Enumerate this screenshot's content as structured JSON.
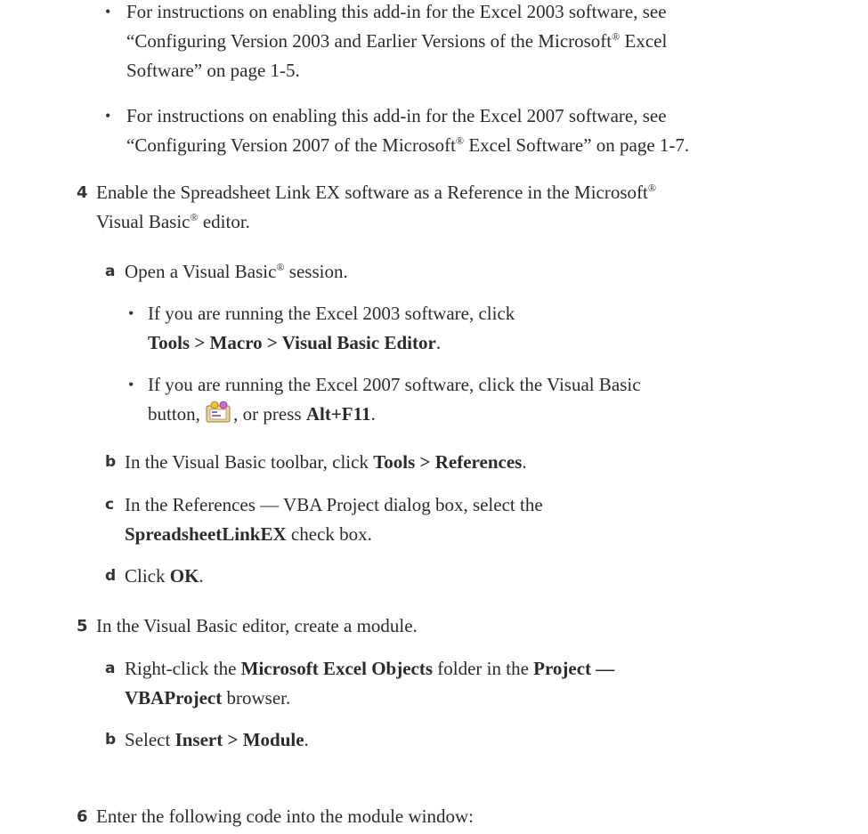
{
  "bullets_top": [
    {
      "line1": "For instructions on enabling this add-in for the Excel 2003 software, see",
      "line2_a": "“Configuring Version 2003 and Earlier Versions of the Microsoft",
      "line2_reg": "®",
      "line2_b": " Excel",
      "line3": "Software” on page 1-5."
    },
    {
      "line1": "For instructions on enabling this add-in for the Excel 2007 software, see",
      "line2_a": "“Configuring Version 2007 of the Microsoft",
      "line2_reg": "®",
      "line2_b": " Excel Software” on page 1-7."
    }
  ],
  "bullet_char": "•",
  "step4": {
    "num": "4",
    "line1_a": "Enable the Spreadsheet Link EX software as a Reference in the Microsoft",
    "reg": "®",
    "line2_a": "Visual Basic",
    "line2_b": " editor.",
    "a": {
      "letter": "a",
      "text_a": "Open a Visual Basic",
      "text_b": " session.",
      "bullet1": {
        "line1": "If you are running the Excel 2003 software, click",
        "line2_bold": "Tools > Macro > Visual Basic Editor",
        "line2_end": "."
      },
      "bullet2": {
        "line1": "If you are running the Excel 2007 software, click the Visual Basic",
        "line2_a": "button, ",
        "line2_b": ", or press ",
        "line2_bold": "Alt+F11",
        "line2_end": "."
      }
    },
    "b": {
      "letter": "b",
      "text": "In the Visual Basic toolbar, click ",
      "bold": "Tools > References",
      "end": "."
    },
    "c": {
      "letter": "c",
      "line1": "In the References — VBA Project dialog box, select the",
      "line2_bold": "SpreadsheetLinkEX",
      "line2_end": " check box."
    },
    "d": {
      "letter": "d",
      "text": "Click ",
      "bold": "OK",
      "end": "."
    }
  },
  "step5": {
    "num": "5",
    "text": "In the Visual Basic editor, create a module.",
    "a": {
      "letter": "a",
      "text": "Right-click the ",
      "bold1": "Microsoft Excel Objects",
      "mid": " folder in the ",
      "bold2": "Project —",
      "line2_bold": "VBAProject",
      "line2_end": " browser."
    },
    "b": {
      "letter": "b",
      "text": "Select ",
      "bold": "Insert > Module",
      "end": "."
    }
  },
  "step6": {
    "num": "6",
    "text": "Enter the following code into the module window:"
  },
  "icons": {
    "visual_basic": "visual-basic-ribbon-icon"
  }
}
